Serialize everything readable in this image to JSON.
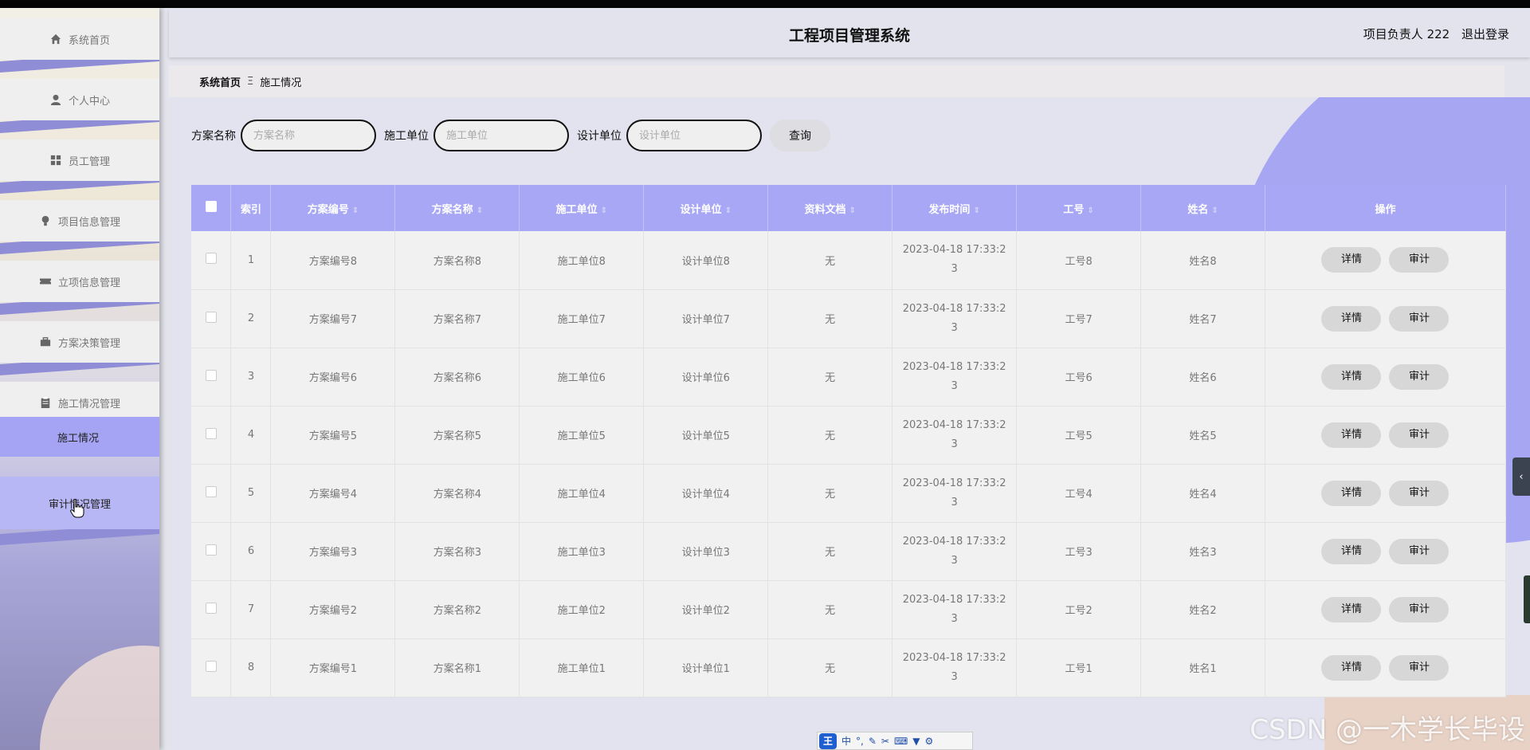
{
  "header": {
    "title": "工程项目管理系统",
    "user_label": "项目负责人 222",
    "logout_label": "退出登录"
  },
  "sidebar": {
    "items": [
      {
        "label": "系统首页",
        "icon": "home-icon"
      },
      {
        "label": "个人中心",
        "icon": "user-icon"
      },
      {
        "label": "员工管理",
        "icon": "grid-icon"
      },
      {
        "label": "项目信息管理",
        "icon": "bulb-icon"
      },
      {
        "label": "立项信息管理",
        "icon": "ticket-icon"
      },
      {
        "label": "方案决策管理",
        "icon": "briefcase-icon"
      },
      {
        "label": "施工情况管理",
        "icon": "clipboard-icon"
      }
    ],
    "sub_item": "施工情况",
    "active_item": {
      "label": "审计情况管理",
      "icon": "chat-icon"
    }
  },
  "breadcrumb": {
    "home": "系统首页",
    "separator": "Ξ",
    "current": "施工情况"
  },
  "search": {
    "fields": [
      {
        "label": "方案名称",
        "placeholder": "方案名称"
      },
      {
        "label": "施工单位",
        "placeholder": "施工单位"
      },
      {
        "label": "设计单位",
        "placeholder": "设计单位"
      }
    ],
    "button": "查询"
  },
  "table": {
    "headers": [
      "索引",
      "方案编号",
      "方案名称",
      "施工单位",
      "设计单位",
      "资料文档",
      "发布时间",
      "工号",
      "姓名",
      "操作"
    ],
    "sort_glyph": "⇕",
    "detail_label": "详情",
    "audit_label": "审计",
    "rows": [
      {
        "index": "1",
        "plan_no": "方案编号8",
        "plan_name": "方案名称8",
        "builder": "施工单位8",
        "designer": "设计单位8",
        "doc": "无",
        "time_a": "2023-04-18 17:33:2",
        "time_b": "3",
        "emp_no": "工号8",
        "name": "姓名8"
      },
      {
        "index": "2",
        "plan_no": "方案编号7",
        "plan_name": "方案名称7",
        "builder": "施工单位7",
        "designer": "设计单位7",
        "doc": "无",
        "time_a": "2023-04-18 17:33:2",
        "time_b": "3",
        "emp_no": "工号7",
        "name": "姓名7"
      },
      {
        "index": "3",
        "plan_no": "方案编号6",
        "plan_name": "方案名称6",
        "builder": "施工单位6",
        "designer": "设计单位6",
        "doc": "无",
        "time_a": "2023-04-18 17:33:2",
        "time_b": "3",
        "emp_no": "工号6",
        "name": "姓名6"
      },
      {
        "index": "4",
        "plan_no": "方案编号5",
        "plan_name": "方案名称5",
        "builder": "施工单位5",
        "designer": "设计单位5",
        "doc": "无",
        "time_a": "2023-04-18 17:33:2",
        "time_b": "3",
        "emp_no": "工号5",
        "name": "姓名5"
      },
      {
        "index": "5",
        "plan_no": "方案编号4",
        "plan_name": "方案名称4",
        "builder": "施工单位4",
        "designer": "设计单位4",
        "doc": "无",
        "time_a": "2023-04-18 17:33:2",
        "time_b": "3",
        "emp_no": "工号4",
        "name": "姓名4"
      },
      {
        "index": "6",
        "plan_no": "方案编号3",
        "plan_name": "方案名称3",
        "builder": "施工单位3",
        "designer": "设计单位3",
        "doc": "无",
        "time_a": "2023-04-18 17:33:2",
        "time_b": "3",
        "emp_no": "工号3",
        "name": "姓名3"
      },
      {
        "index": "7",
        "plan_no": "方案编号2",
        "plan_name": "方案名称2",
        "builder": "施工单位2",
        "designer": "设计单位2",
        "doc": "无",
        "time_a": "2023-04-18 17:33:2",
        "time_b": "3",
        "emp_no": "工号2",
        "name": "姓名2"
      },
      {
        "index": "8",
        "plan_no": "方案编号1",
        "plan_name": "方案名称1",
        "builder": "施工单位1",
        "designer": "设计单位1",
        "doc": "无",
        "time_a": "2023-04-18 17:33:2",
        "time_b": "3",
        "emp_no": "工号1",
        "name": "姓名1"
      }
    ]
  },
  "ime": {
    "logo": "王",
    "mode": "中",
    "punct": "°,"
  },
  "watermark": "CSDN @一木学长毕设",
  "colors": {
    "accent": "#a8a7f5",
    "active_menu": "#b8b7f5",
    "sub_menu": "#a5a4f4"
  }
}
